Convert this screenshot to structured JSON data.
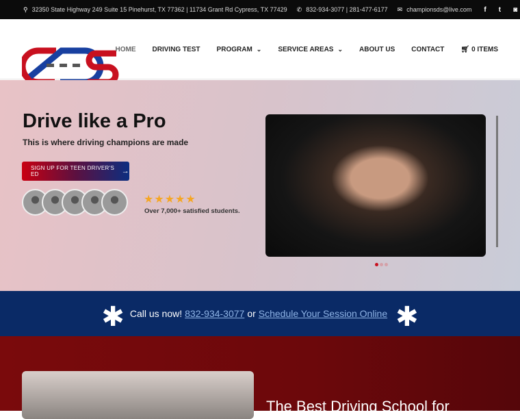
{
  "topbar": {
    "address": "32350 State Highway 249 Suite 15 Pinehurst, TX 77362 | 11734 Grant Rd Cypress, TX 77429",
    "phones": "832-934-3077 | 281-477-6177",
    "email": "championsds@live.com",
    "social": [
      "facebook-icon",
      "twitter-icon",
      "instagram-icon"
    ]
  },
  "logo": {
    "text": "CDS"
  },
  "nav": {
    "items": [
      {
        "label": "HOME"
      },
      {
        "label": "DRIVING TEST"
      },
      {
        "label": "PROGRAM"
      },
      {
        "label": "SERVICE AREAS"
      },
      {
        "label": "ABOUT US"
      },
      {
        "label": "CONTACT"
      },
      {
        "label": "0 ITEMS"
      }
    ]
  },
  "hero": {
    "title": "Drive like a Pro",
    "subtitle": "This is where driving champions are made",
    "cta": "SIGN UP FOR TEEN DRIVER'S ED",
    "rating": 5,
    "stars": "★★★★★",
    "students": "Over 7,000+ satisfied students.",
    "slide_count": 3,
    "active_slide": 1
  },
  "band": {
    "prefix": "Call us now!",
    "phone": "832-934-3077",
    "or": "or",
    "schedule": "Schedule Your Session Online"
  },
  "section": {
    "heading": "The Best Driving School for"
  },
  "colors": {
    "brand_red": "#c8101f",
    "brand_blue": "#0a2a66",
    "star": "#f5a623"
  }
}
